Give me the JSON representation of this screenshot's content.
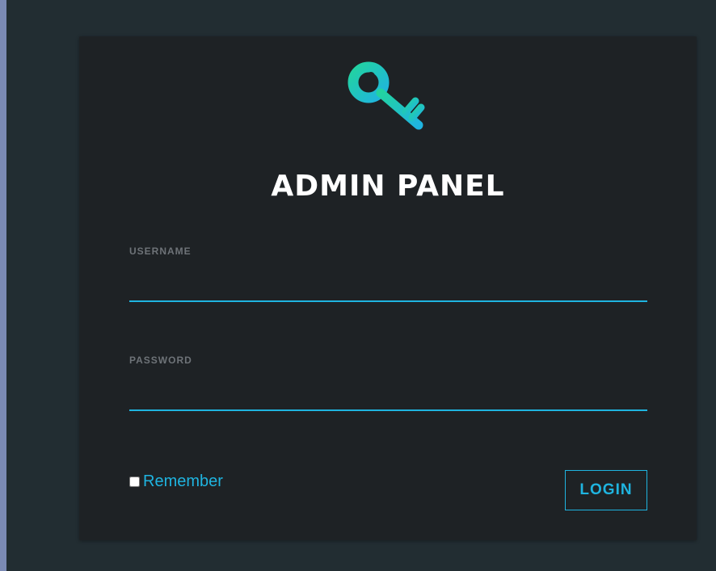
{
  "login": {
    "title": "ADMIN PANEL",
    "username_label": "USERNAME",
    "username_value": "",
    "password_label": "PASSWORD",
    "password_value": "",
    "remember_label": "Remember",
    "remember_checked": false,
    "login_button": "LOGIN",
    "logo_icon": "key-icon"
  },
  "colors": {
    "page_background": "#222d32",
    "card_background": "#1e2225",
    "accent": "#1fb4e0",
    "logo_gradient_start": "#22d3a0",
    "logo_gradient_end": "#1fb4e0",
    "label_text": "#6e7378",
    "title_text": "#ffffff"
  }
}
